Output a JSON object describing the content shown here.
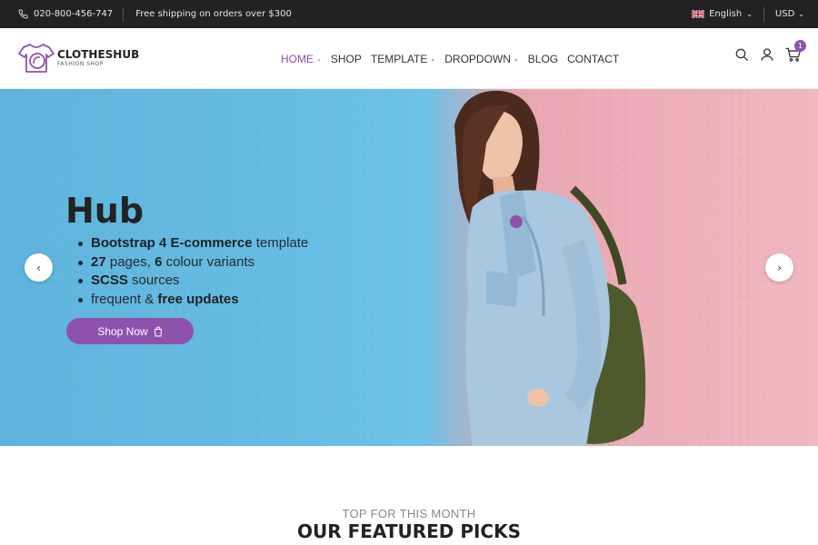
{
  "topbar": {
    "phone": "020-800-456-747",
    "shipping": "Free shipping on orders over $300",
    "language": "English",
    "currency": "USD"
  },
  "header": {
    "logo_name": "CLOTHESHUB",
    "logo_sub": "FASHION SHOP",
    "nav": [
      {
        "label": "HOME",
        "dropdown": true,
        "active": true
      },
      {
        "label": "SHOP",
        "dropdown": false
      },
      {
        "label": "TEMPLATE",
        "dropdown": true
      },
      {
        "label": "DROPDOWN",
        "dropdown": true
      },
      {
        "label": "BLOG",
        "dropdown": false
      },
      {
        "label": "CONTACT",
        "dropdown": false
      }
    ],
    "cart_count": "1",
    "icons": [
      "search-icon",
      "user-icon",
      "cart-icon"
    ]
  },
  "hero": {
    "title": "Hub",
    "bullets": [
      {
        "bold": "Bootstrap 4 E-commerce",
        "rest": " template"
      },
      {
        "bold": "27",
        "rest": " pages, ",
        "bold2": "6",
        "rest2": " colour variants"
      },
      {
        "bold": "SCSS",
        "rest": " sources"
      },
      {
        "pre": "frequent & ",
        "bold": "free updates"
      }
    ],
    "button_label": "Shop Now"
  },
  "featured": {
    "eyebrow": "TOP FOR THIS MONTH",
    "heading": "OUR FEATURED PICKS"
  },
  "colors": {
    "accent": "#8e52ad",
    "topbar": "#222222",
    "hero_blue": "#66bde3",
    "hero_pink": "#f1b8bf"
  }
}
